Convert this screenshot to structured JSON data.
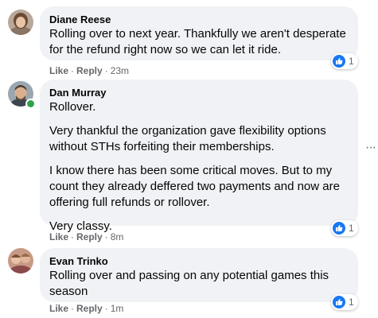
{
  "comments": [
    {
      "author": "Diane Reese",
      "paragraphs": [
        "Rolling over to next year. Thankfully we aren't desperate for the refund right now so we can let it ride."
      ],
      "reaction_count": "1",
      "like_label": "Like",
      "reply_label": "Reply",
      "time": "23m",
      "online": false
    },
    {
      "author": "Dan Murray",
      "paragraphs": [
        "Rollover.",
        "Very thankful the organization gave flexibility options without STHs forfeiting their memberships.",
        "I know there has been some critical moves. But to my count they already deffered two payments and now are offering full refunds or rollover.",
        "Very classy."
      ],
      "reaction_count": "1",
      "like_label": "Like",
      "reply_label": "Reply",
      "time": "8m",
      "online": true
    },
    {
      "author": "Evan Trinko",
      "paragraphs": [
        "Rolling over and passing on any potential games this season"
      ],
      "reaction_count": "1",
      "like_label": "Like",
      "reply_label": "Reply",
      "time": "1m",
      "online": false
    }
  ],
  "more_options": "···",
  "separator": "·",
  "colors": {
    "bubble": "#f0f2f5",
    "link_blue": "#1877f2",
    "meta_gray": "#65676b",
    "online_green": "#31a24c"
  },
  "icons": [
    "like-icon",
    "more-options-icon",
    "avatar-diane",
    "avatar-dan",
    "avatar-evan"
  ]
}
